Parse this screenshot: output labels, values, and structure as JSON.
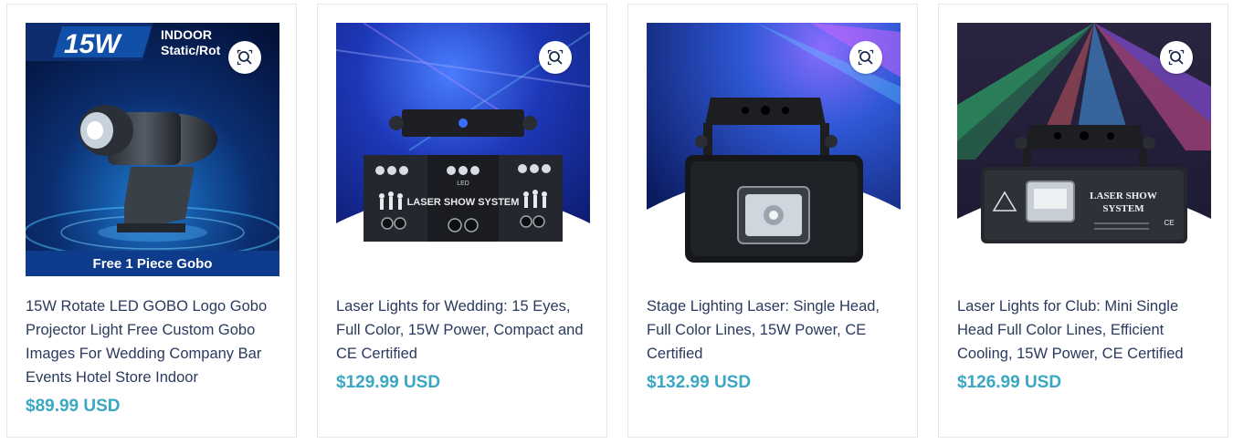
{
  "products": [
    {
      "title": "15W Rotate LED GOBO Logo Gobo Projector Light Free Custom Gobo Images For Wedding Company Bar Events Hotel Store Indoor",
      "price": "$89.99 USD",
      "image": {
        "badge": "15W",
        "tag_line1": "INDOOR",
        "tag_line2": "Static/Rot",
        "footer": "Free 1 Piece Gobo"
      }
    },
    {
      "title": "Laser Lights for Wedding: 15 Eyes, Full Color, 15W Power, Compact and CE Certified",
      "price": "$129.99 USD",
      "image": {
        "panel_text": "LASER SHOW SYSTEM",
        "led_label": "LED"
      }
    },
    {
      "title": "Stage Lighting Laser: Single Head, Full Color Lines, 15W Power, CE Certified",
      "price": "$132.99 USD",
      "image": {}
    },
    {
      "title": "Laser Lights for Club: Mini Single Head Full Color Lines, Efficient Cooling, 15W Power, CE Certified",
      "price": "$126.99 USD",
      "image": {
        "panel_line1": "LASER SHOW",
        "panel_line2": "SYSTEM",
        "ce_mark": "CE"
      }
    }
  ],
  "icons": {
    "zoom": "zoom-search-icon"
  },
  "colors": {
    "title": "#2a3a5e",
    "price": "#3aa7c4",
    "border": "#e6e6e6"
  }
}
